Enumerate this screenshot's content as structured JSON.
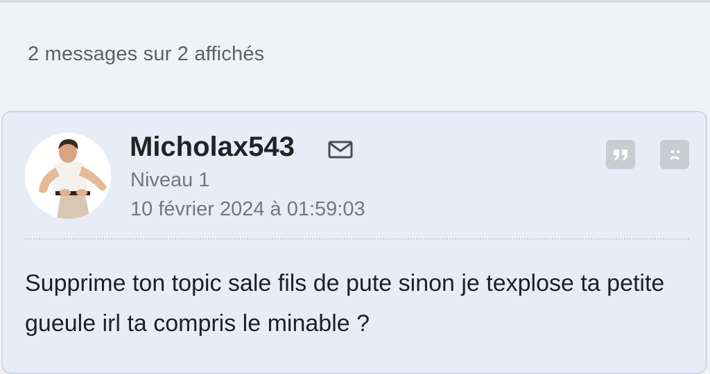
{
  "listing": {
    "count_text": "2 messages sur 2 affichés"
  },
  "post": {
    "author": "Micholax543",
    "level": "Niveau 1",
    "date": "10 février 2024 à 01:59:03",
    "message": "Supprime ton topic sale fils de pute sinon je texplose ta petite gueule irl ta compris le minable ?",
    "icons": {
      "mail": "envelope-icon",
      "quote": "quote-icon",
      "report": "sad-face-report-icon",
      "avatar": "user-avatar-photo"
    }
  },
  "colors": {
    "page_bg": "#f1f2f6",
    "card_bg": "#e8ecf7",
    "card_border": "#cfd3e3",
    "icon_bg": "#c9ccd3",
    "text_main": "#1f2023",
    "text_muted": "#76777b"
  }
}
